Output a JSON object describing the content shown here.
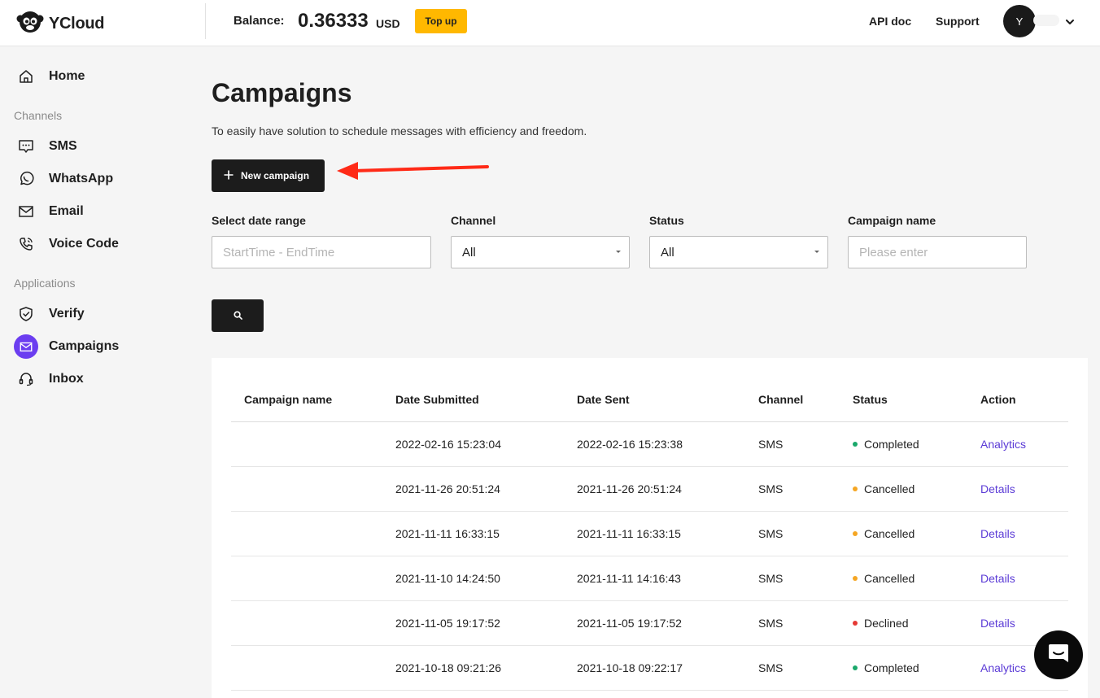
{
  "header": {
    "brand": "YCloud",
    "balance_label": "Balance:",
    "balance_value": "0.36333",
    "currency": "USD",
    "topup_label": "Top up",
    "api_doc": "API doc",
    "support": "Support",
    "avatar_initial": "Y"
  },
  "sidebar": {
    "home": "Home",
    "channels_section": "Channels",
    "channels": [
      "SMS",
      "WhatsApp",
      "Email",
      "Voice Code"
    ],
    "applications_section": "Applications",
    "applications": [
      "Verify",
      "Campaigns",
      "Inbox"
    ],
    "active": "Campaigns",
    "active_color": "#6b3df0"
  },
  "main": {
    "title": "Campaigns",
    "subtitle": "To easily have solution to schedule messages with efficiency and freedom.",
    "new_campaign_label": "New campaign",
    "annotation_arrow_color": "#ff2a17"
  },
  "filters": {
    "date_label": "Select date range",
    "date_placeholder": "StartTime - EndTime",
    "channel_label": "Channel",
    "channel_value": "All",
    "status_label": "Status",
    "status_value": "All",
    "name_label": "Campaign name",
    "name_placeholder": "Please enter"
  },
  "table": {
    "headers": [
      "Campaign name",
      "Date Submitted",
      "Date Sent",
      "Channel",
      "Status",
      "Action"
    ],
    "rows": [
      {
        "name": "",
        "submitted": "2022-02-16 15:23:04",
        "sent": "2022-02-16 15:23:38",
        "channel": "SMS",
        "status": "Completed",
        "action": "Analytics"
      },
      {
        "name": "",
        "submitted": "2021-11-26 20:51:24",
        "sent": "2021-11-26 20:51:24",
        "channel": "SMS",
        "status": "Cancelled",
        "action": "Details"
      },
      {
        "name": "",
        "submitted": "2021-11-11 16:33:15",
        "sent": "2021-11-11 16:33:15",
        "channel": "SMS",
        "status": "Cancelled",
        "action": "Details"
      },
      {
        "name": "",
        "submitted": "2021-11-10 14:24:50",
        "sent": "2021-11-11 14:16:43",
        "channel": "SMS",
        "status": "Cancelled",
        "action": "Details"
      },
      {
        "name": "",
        "submitted": "2021-11-05 19:17:52",
        "sent": "2021-11-05 19:17:52",
        "channel": "SMS",
        "status": "Declined",
        "action": "Details"
      },
      {
        "name": "",
        "submitted": "2021-10-18 09:21:26",
        "sent": "2021-10-18 09:22:17",
        "channel": "SMS",
        "status": "Completed",
        "action": "Analytics"
      }
    ],
    "status_colors": {
      "Completed": "#1aa86b",
      "Cancelled": "#f5a623",
      "Declined": "#e53935"
    },
    "action_color": "#5b3bd6"
  }
}
